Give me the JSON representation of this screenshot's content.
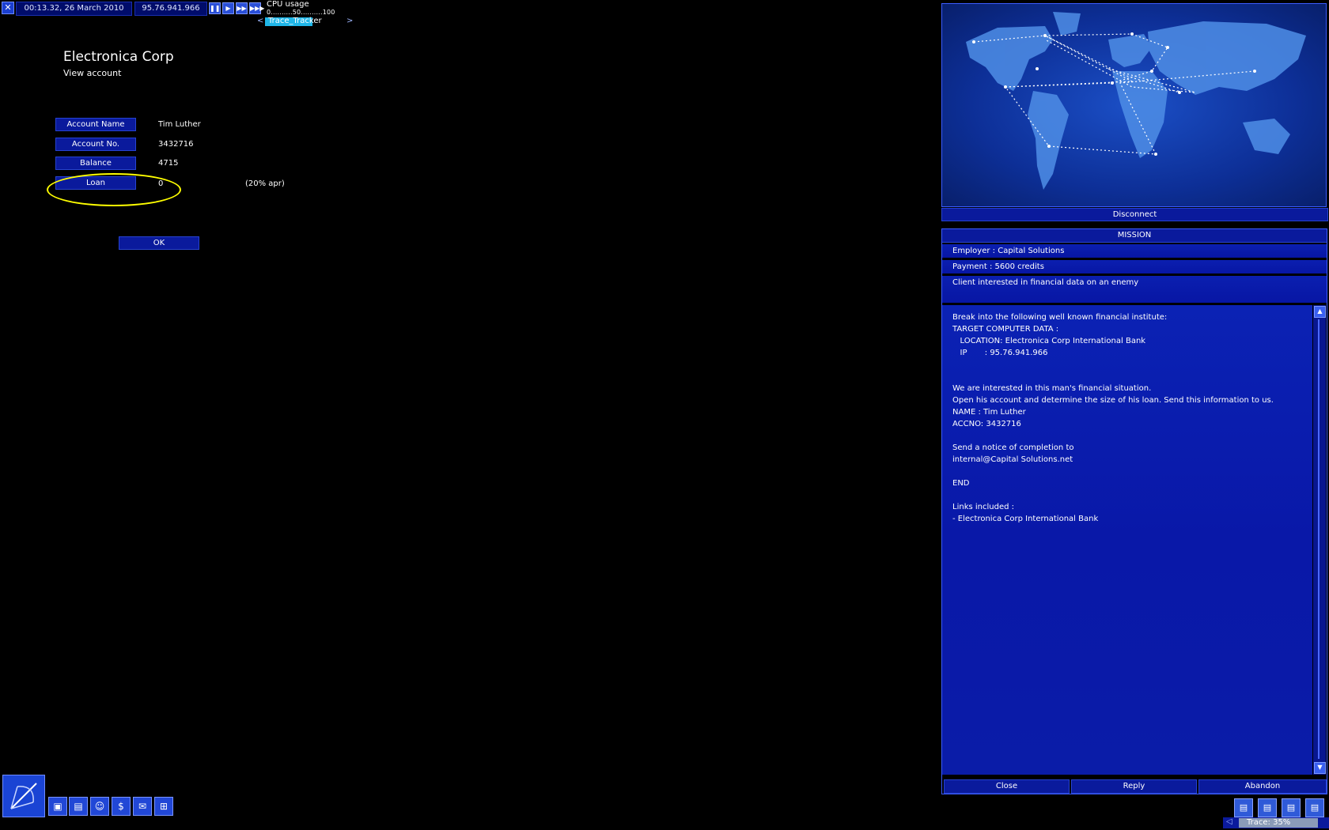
{
  "topbar": {
    "close_glyph": "✕",
    "datetime": "00:13.32, 26 March 2010",
    "ip": "95.76.941.966",
    "speed_buttons": [
      "❚❚",
      "▶",
      "▶▶",
      "▶▶▶"
    ],
    "cpu_label": "CPU usage",
    "cpu_scale": "0..........50..........100",
    "tracker_label": "Trace_Tracker",
    "tracker_prev": "<",
    "tracker_next": ">"
  },
  "page": {
    "title": "Electronica Corp",
    "subtitle": "View account",
    "fields": [
      {
        "label": "Account Name",
        "value": "Tim Luther"
      },
      {
        "label": "Account No.",
        "value": "3432716"
      },
      {
        "label": "Balance",
        "value": "4715"
      },
      {
        "label": "Loan",
        "value": "0"
      }
    ],
    "apr": "(20% apr)",
    "ok_label": "OK"
  },
  "map": {
    "disconnect_label": "Disconnect"
  },
  "mission": {
    "header": "MISSION",
    "employer": "Employer : Capital Solutions",
    "payment": "Payment : 5600 credits",
    "summary": "Client interested in financial data on an enemy",
    "body_lines": [
      "Break into the following well known financial institute:",
      "TARGET COMPUTER DATA :",
      "   LOCATION: Electronica Corp International Bank",
      "   IP       : 95.76.941.966",
      "",
      "",
      "We are interested in this man's financial situation.",
      "Open his account and determine the size of his loan. Send this information to us.",
      "NAME : Tim Luther",
      "ACCNO: 3432716",
      "",
      "Send a notice of completion to",
      "internal@Capital Solutions.net",
      "",
      "END",
      "",
      "Links included :",
      "- Electronica Corp International Bank"
    ],
    "close_label": "Close",
    "reply_label": "Reply",
    "abandon_label": "Abandon",
    "scroll_up": "▲",
    "scroll_down": "▼"
  },
  "toolbar": {
    "buttons": [
      {
        "name": "hardware-icon",
        "glyph": "▣"
      },
      {
        "name": "disk-icon",
        "glyph": "▤"
      },
      {
        "name": "person-icon",
        "glyph": "☺"
      },
      {
        "name": "finance-icon",
        "glyph": "$"
      },
      {
        "name": "email-icon",
        "glyph": "✉"
      },
      {
        "name": "network-icon",
        "glyph": "⊞"
      }
    ]
  },
  "bottom_right": {
    "buttons": [
      "▤",
      "▤",
      "▤",
      "▤"
    ],
    "trace_text": "Trace: 35%",
    "trace_level": 0.35,
    "trace_arrow": "◁"
  },
  "colors": {
    "accent": "#0a1a9c",
    "highlight_circle": "#ffff00",
    "tracker_fill": "#1fb6e8"
  }
}
